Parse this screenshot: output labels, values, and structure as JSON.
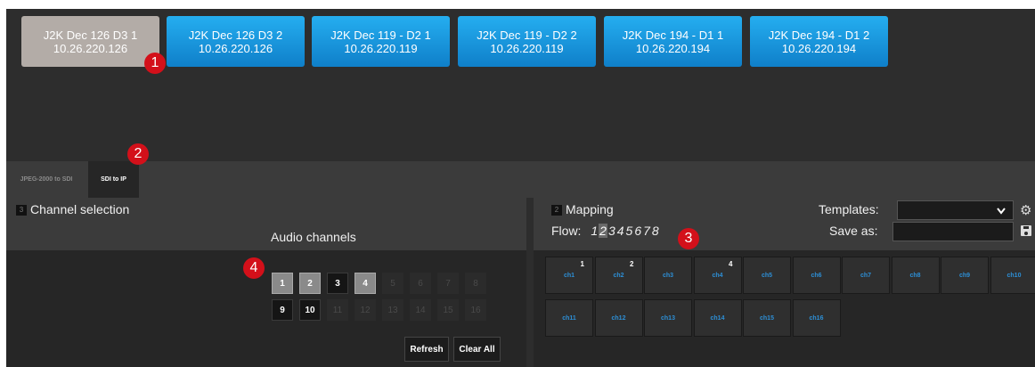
{
  "devices": [
    {
      "name": "J2K Dec 126 D3 1",
      "ip": "10.26.220.126",
      "active": true
    },
    {
      "name": "J2K Dec 126 D3 2",
      "ip": "10.26.220.126",
      "active": false
    },
    {
      "name": "J2K Dec 119 - D2 1",
      "ip": "10.26.220.119",
      "active": false
    },
    {
      "name": "J2K Dec 119 - D2 2",
      "ip": "10.26.220.119",
      "active": false
    },
    {
      "name": "J2K Dec 194 - D1 1",
      "ip": "10.26.220.194",
      "active": false
    },
    {
      "name": "J2K Dec 194 - D1 2",
      "ip": "10.26.220.194",
      "active": false
    }
  ],
  "markers": [
    "1",
    "2",
    "3",
    "4"
  ],
  "tabs": {
    "jpeg": "JPEG-2000 to SDI",
    "sdi": "SDI to IP"
  },
  "channel_selection": {
    "number": "3",
    "title": "Channel selection",
    "audio_title": "Audio channels"
  },
  "audio_channels": [
    "1",
    "2",
    "3",
    "4",
    "5",
    "6",
    "7",
    "8",
    "9",
    "10",
    "11",
    "12",
    "13",
    "14",
    "15",
    "16"
  ],
  "audio_state": [
    "sel",
    "sel",
    "on",
    "sel",
    "off",
    "off",
    "off",
    "off",
    "on",
    "on",
    "off",
    "off",
    "off",
    "off",
    "off",
    "off"
  ],
  "buttons": {
    "refresh": "Refresh",
    "clear_all": "Clear All"
  },
  "mapping": {
    "number": "2",
    "title": "Mapping",
    "flow_label": "Flow:",
    "flows": [
      "1",
      "2",
      "3",
      "4",
      "5",
      "6",
      "7",
      "8"
    ],
    "current_flow": "2",
    "templates_label": "Templates:",
    "save_as_label": "Save as:",
    "template_value": "",
    "save_as_value": ""
  },
  "mapping_channels": [
    {
      "label": "ch1",
      "sup": "1"
    },
    {
      "label": "ch2",
      "sup": "2"
    },
    {
      "label": "ch3",
      "sup": ""
    },
    {
      "label": "ch4",
      "sup": "4"
    },
    {
      "label": "ch5",
      "sup": ""
    },
    {
      "label": "ch6",
      "sup": ""
    },
    {
      "label": "ch7",
      "sup": ""
    },
    {
      "label": "ch8",
      "sup": ""
    },
    {
      "label": "ch9",
      "sup": ""
    },
    {
      "label": "ch10",
      "sup": ""
    },
    {
      "label": "ch11",
      "sup": ""
    },
    {
      "label": "ch12",
      "sup": ""
    },
    {
      "label": "ch13",
      "sup": ""
    },
    {
      "label": "ch14",
      "sup": ""
    },
    {
      "label": "ch15",
      "sup": ""
    },
    {
      "label": "ch16",
      "sup": ""
    }
  ],
  "icons": {
    "dropdown": "chevron-down-icon",
    "settings": "gear-icon",
    "save": "save-icon"
  }
}
